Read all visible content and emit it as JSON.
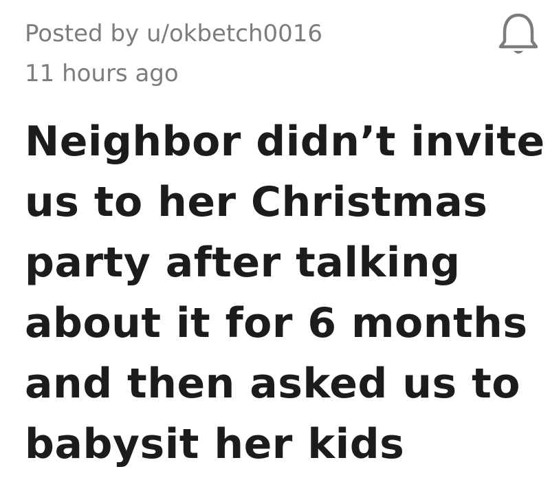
{
  "post": {
    "posted_by": "Posted by u/okbetch0016",
    "time_ago": "11 hours ago",
    "title_lines": [
      "Neighbor didn’t invite",
      "us to her Christmas",
      "party after talking",
      "about it for 6 months",
      "and then asked us to",
      "babysit her kids"
    ],
    "notification_icon": "bell-icon"
  },
  "colors": {
    "meta_text": "#7c7c7c",
    "title_text": "#1c1c1c",
    "icon_stroke": "#7c7c7c",
    "background": "#ffffff"
  }
}
